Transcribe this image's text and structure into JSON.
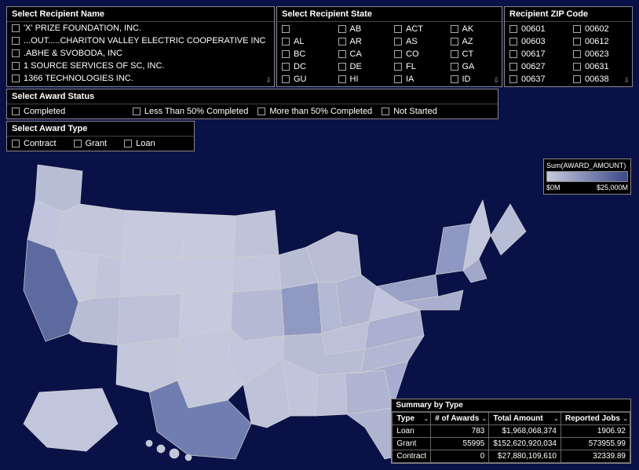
{
  "filters": {
    "recipient_name": {
      "title": "Select Recipient Name",
      "items": [
        "'X' PRIZE FOUNDATION, INC.",
        "...OUT.....CHARITON VALLEY ELECTRIC COOPERATIVE INC",
        ".ABHE & SVOBODA, INC",
        "1 SOURCE SERVICES OF SC, INC.",
        "1366 TECHNOLOGIES INC."
      ]
    },
    "recipient_state": {
      "title": "Select Recipient State",
      "items": [
        "",
        "AB",
        "ACT",
        "AK",
        "AL",
        "AR",
        "AS",
        "AZ",
        "BC",
        "CA",
        "CO",
        "CT",
        "DC",
        "DE",
        "FL",
        "GA",
        "GU",
        "HI",
        "IA",
        "ID"
      ]
    },
    "recipient_zip": {
      "title": "Recipient ZIP Code",
      "items": [
        "00601",
        "00602",
        "00603",
        "00612",
        "00617",
        "00623",
        "00627",
        "00631",
        "00637",
        "00638"
      ]
    },
    "award_status": {
      "title": "Select Award Status",
      "items": [
        "Completed",
        "Less Than 50% Completed",
        "More than 50% Completed",
        "Not Started"
      ]
    },
    "award_type": {
      "title": "Select Award Type",
      "items": [
        "Contract",
        "Grant",
        "Loan"
      ]
    }
  },
  "legend": {
    "title": "Sum(AWARD_AMOUNT)",
    "min": "$0M",
    "max": "$25,000M"
  },
  "summary": {
    "title": "Summary by Type",
    "headers": [
      "Type",
      "# of Awards",
      "Total Amount",
      "Reported Jobs"
    ],
    "rows": [
      {
        "type": "Loan",
        "awards": "783",
        "amount": "$1,968,068,374",
        "jobs": "1906.92"
      },
      {
        "type": "Grant",
        "awards": "55995",
        "amount": "$152,620,920,034",
        "jobs": "573955.99"
      },
      {
        "type": "Contract",
        "awards": "0",
        "amount": "$27,880,109,610",
        "jobs": "32339.89"
      }
    ]
  },
  "chart_data": {
    "type": "choropleth-map",
    "region": "USA states",
    "measure": "Sum(AWARD_AMOUNT)",
    "scale_min_label": "$0M",
    "scale_max_label": "$25,000M",
    "note": "Per-state values are encoded by shading intensity; CA and TX appear darkest (highest); most other states light blue-gray."
  }
}
